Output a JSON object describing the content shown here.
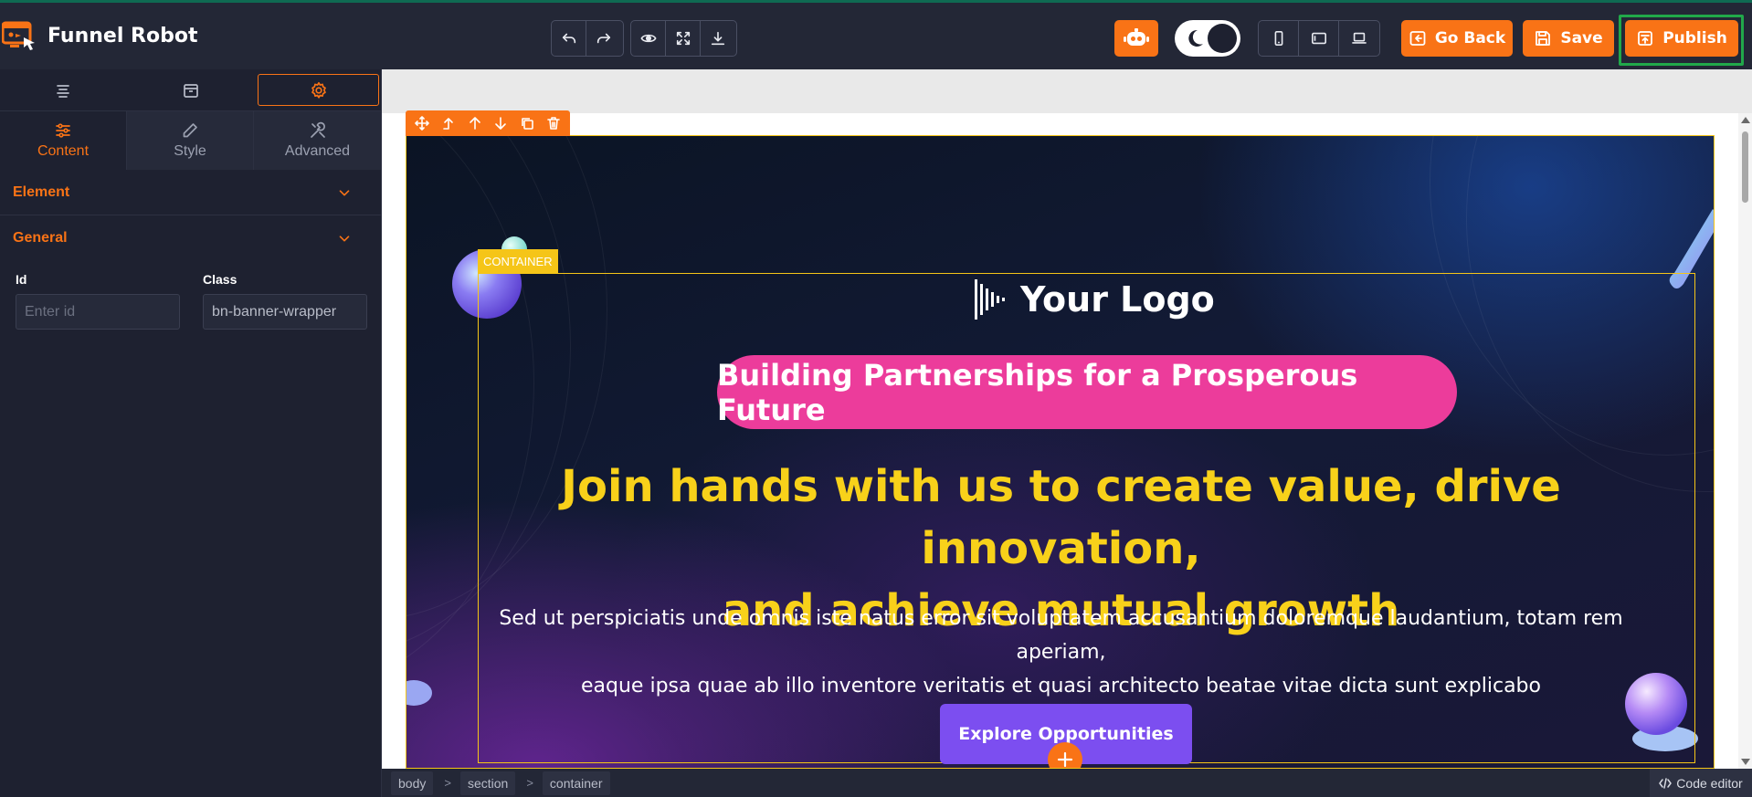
{
  "app": {
    "name": "Funnel Robot"
  },
  "toolbar": {
    "undo_icon": "undo-icon",
    "redo_icon": "redo-icon",
    "preview_icon": "eye-icon",
    "fullscreen_icon": "expand-icon",
    "download_icon": "download-icon",
    "go_back_label": "Go Back",
    "save_label": "Save",
    "publish_label": "Publish"
  },
  "colors": {
    "accent": "#f97316",
    "highlight": "#21a84a",
    "pill": "#ec3c9b",
    "headline": "#f8d11a",
    "cta": "#7c4ef0"
  },
  "sidebar": {
    "sub_tabs": [
      {
        "label": "Content",
        "icon": "sliders-icon"
      },
      {
        "label": "Style",
        "icon": "pencil-icon"
      },
      {
        "label": "Advanced",
        "icon": "tools-icon"
      }
    ],
    "sections": [
      {
        "title": "Element"
      },
      {
        "title": "General"
      }
    ],
    "fields": {
      "id_label": "Id",
      "id_placeholder": "Enter id",
      "class_label": "Class",
      "class_value": "bn-banner-wrapper"
    }
  },
  "canvas": {
    "container_tag": "CONTAINER",
    "logo_text": "Your Logo",
    "pill_text": "Building Partnerships for a Prosperous Future",
    "headline_line1": "Join hands with us to create value, drive innovation,",
    "headline_line2": "and achieve mutual growth",
    "desc_line1": "Sed ut perspiciatis unde omnis iste natus error sit voluptatem accusantium doloremque laudantium, totam rem aperiam,",
    "desc_line2": "eaque ipsa quae ab illo inventore veritatis et quasi architecto beatae vitae dicta sunt explicabo",
    "cta_label": "Explore Opportunities"
  },
  "breadcrumb": [
    "body",
    "section",
    "container"
  ],
  "code_editor_label": "Code editor"
}
